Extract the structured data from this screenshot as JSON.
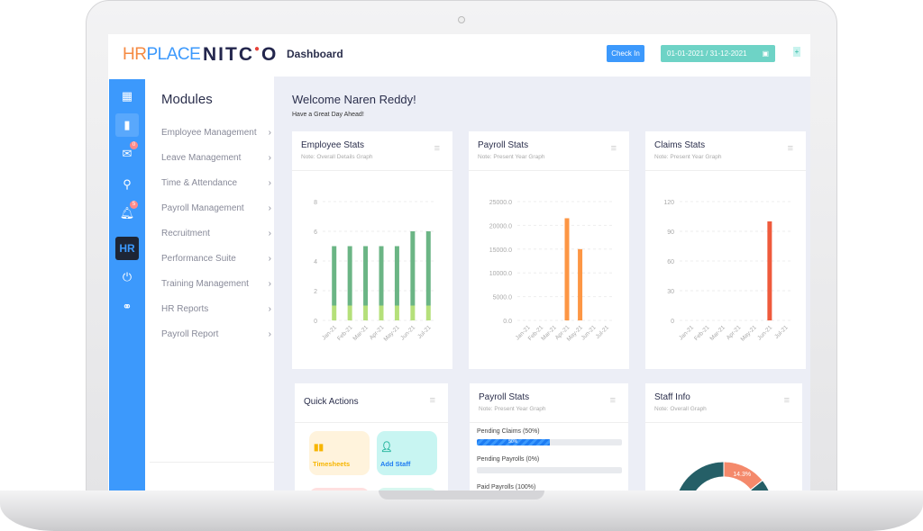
{
  "header": {
    "logo_primary": "HRPLACE",
    "logo_secondary": "NITCO",
    "title": "Dashboard",
    "checkin_label": "Check In",
    "date_range": "01-01-2021 / 31-12-2021"
  },
  "rail": {
    "badges": {
      "announcements": "0",
      "notifications": "5"
    },
    "hr_label": "HR"
  },
  "modules": {
    "title": "Modules",
    "items": [
      {
        "label": "Employee Management"
      },
      {
        "label": "Leave Management"
      },
      {
        "label": "Time & Attendance"
      },
      {
        "label": "Payroll Management"
      },
      {
        "label": "Recruitment"
      },
      {
        "label": "Performance Suite"
      },
      {
        "label": "Training Management"
      },
      {
        "label": "HR Reports"
      },
      {
        "label": "Payroll Report"
      }
    ]
  },
  "welcome": {
    "title": "Welcome Naren Reddy!",
    "subtitle": "Have a Great Day Ahead!"
  },
  "cards": {
    "employee": {
      "title": "Employee Stats",
      "note": "Note: Overall Details Graph"
    },
    "payroll": {
      "title": "Payroll Stats",
      "note": "Note: Present Year Graph"
    },
    "claims": {
      "title": "Claims Stats",
      "note": "Note: Present Year Graph"
    },
    "quick": {
      "title": "Quick Actions",
      "actions": [
        {
          "label": "Timesheets",
          "color": "#f7b500"
        },
        {
          "label": "Add Staff",
          "color": "#1e7cf2"
        }
      ]
    },
    "payroll2": {
      "title": "Payroll Stats",
      "note": "Note: Present Year Graph",
      "bars": [
        {
          "label": "Pending Claims (50%)",
          "percent": 50,
          "text": "50%"
        },
        {
          "label": "Pending Payrolls (0%)",
          "percent": 0,
          "text": ""
        },
        {
          "label": "Paid Payrolls (100%)",
          "percent": 100,
          "text": ""
        }
      ]
    },
    "staff": {
      "title": "Staff Info",
      "note": "Note: Overall Graph"
    }
  },
  "chart_data": [
    {
      "type": "bar",
      "stacked": true,
      "categories": [
        "Jan-21",
        "Feb-21",
        "Mar-21",
        "Apr-21",
        "May-21",
        "Jun-21",
        "Jul-21"
      ],
      "series": [
        {
          "values": [
            1,
            1,
            1,
            1,
            1,
            1,
            1
          ],
          "color": "#b5e07a"
        },
        {
          "values": [
            4,
            4,
            4,
            4,
            4,
            5,
            5
          ],
          "color": "#6bb585"
        }
      ],
      "ylim": [
        0,
        8
      ],
      "yticks": [
        "0",
        "2",
        "4",
        "6",
        "8"
      ],
      "grid": true
    },
    {
      "type": "bar",
      "categories": [
        "Jan-21",
        "Feb-21",
        "Mar-21",
        "Apr-21",
        "May-21",
        "Jun-21",
        "Jul-21"
      ],
      "series": [
        {
          "values": [
            0,
            0,
            0,
            21500,
            15000,
            0,
            0
          ],
          "color": "#fd9644"
        }
      ],
      "ylim": [
        0,
        25000
      ],
      "yticks": [
        "0.0",
        "5000.0",
        "10000.0",
        "15000.0",
        "20000.0",
        "25000.0"
      ],
      "grid": true
    },
    {
      "type": "bar",
      "categories": [
        "Jan-21",
        "Feb-21",
        "Mar-21",
        "Apr-21",
        "May-21",
        "Jun-21",
        "Jul-21"
      ],
      "series": [
        {
          "values": [
            0,
            0,
            0,
            0,
            0,
            100,
            0
          ],
          "color": "#ef5a3c"
        }
      ],
      "ylim": [
        0,
        120
      ],
      "yticks": [
        "0",
        "30",
        "60",
        "90",
        "120"
      ],
      "grid": true
    },
    {
      "type": "pie",
      "donut": true,
      "slices": [
        {
          "value": 14.3,
          "label": "14.3%",
          "color": "#f4896b"
        },
        {
          "value": 85.7,
          "label": "",
          "color": "#255f67"
        }
      ]
    }
  ]
}
